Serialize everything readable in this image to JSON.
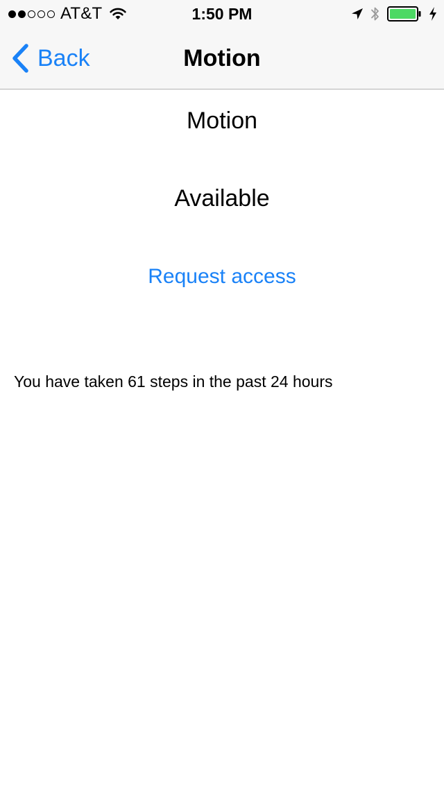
{
  "status_bar": {
    "signal_dots_filled": 2,
    "signal_dots_total": 5,
    "carrier": "AT&T",
    "time": "1:50 PM",
    "icons": [
      "wifi-icon",
      "location-arrow-icon",
      "bluetooth-icon",
      "battery-icon",
      "charging-bolt-icon"
    ],
    "battery_level": 1.0,
    "battery_color": "#4cd964"
  },
  "nav_bar": {
    "back_label": "Back",
    "title": "Motion"
  },
  "content": {
    "heading": "Motion",
    "status": "Available",
    "request_label": "Request access",
    "steps_text": "You have taken 61 steps in the past 24 hours"
  },
  "colors": {
    "accent": "#1a82f7",
    "bar_background": "#f7f7f7",
    "separator": "#b2b2b2"
  }
}
